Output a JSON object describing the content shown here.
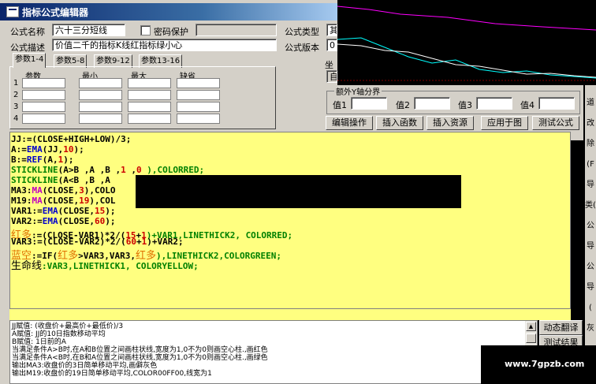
{
  "window": {
    "title": "指标公式编辑器"
  },
  "form": {
    "name_label": "公式名称",
    "name_value": "六十三分短线",
    "password_label": "密码保护",
    "type_label": "公式类型",
    "type_value": "其",
    "desc_label": "公式描述",
    "desc_value": "价值二千的指标K线红指标绿小心",
    "version_label": "公式版本",
    "version_value": "0",
    "coord_label": "坐",
    "self_label": "自"
  },
  "params": {
    "tabs": [
      "参数1-4",
      "参数5-8",
      "参数9-12",
      "参数13-16"
    ],
    "headers": [
      "参数",
      "最小",
      "最大",
      "缺省"
    ],
    "rows": [
      "1",
      "2",
      "3",
      "4"
    ]
  },
  "axis": {
    "group_label": "额外Y轴分界",
    "values": [
      "值1",
      "值2",
      "值3",
      "值4"
    ]
  },
  "buttons": {
    "edit": "编辑操作",
    "insert_func": "插入函数",
    "insert_res": "插入资源",
    "apply": "应用于图",
    "test": "测试公式"
  },
  "code": {
    "l1": "JJ:=(CLOSE+HIGH+LOW)/3;",
    "l2a": "A:=",
    "l2b": "EMA",
    "l2c": "(JJ,",
    "l2d": "10",
    "l2e": ");",
    "l3a": "B:=",
    "l3b": "REF",
    "l3c": "(A,",
    "l3d": "1",
    "l3e": ");",
    "l4a": "STICKLINE",
    "l4b": "(A>B ,A ,B ,",
    "l4c": "1",
    "l4d": " ,",
    "l4e": "0",
    "l4f": " ),COLORRED;",
    "l5a": "STICKLINE",
    "l5b": "(A<B ,B ,A",
    "l6a": "MA3:",
    "l6b": "MA",
    "l6c": "(CLOSE,",
    "l6d": "3",
    "l6e": "),COLO",
    "l7a": "M19:",
    "l7b": "MA",
    "l7c": "(CLOSE,",
    "l7d": "19",
    "l7e": "),COL",
    "l8a": "VAR1:=",
    "l8b": "EMA",
    "l8c": "(CLOSE,",
    "l8d": "15",
    "l8e": ");",
    "l9a": "VAR2:=",
    "l9b": "EMA",
    "l9c": "(CLOSE,",
    "l9d": "60",
    "l9e": ");",
    "l10a": "红多",
    "l10b": ":=(CLOSE-VAR1)*2/(",
    "l10c": "15",
    "l10d": "+",
    "l10e": "1",
    "l10f": ")+VAR1,LINETHICK2, COLORRED;",
    "l11a": "VAR3:=(CLOSE-VAR2)*2/(",
    "l11b": "60",
    "l11c": "+",
    "l11d": "1",
    "l11e": ")+VAR2;",
    "l12a": "蓝空",
    "l12b": ":=IF(",
    "l12c": "红多",
    "l12d": ">VAR3,VAR3,",
    "l12e": "红多",
    "l12f": "),LINETHICK2,COLORGREEN;",
    "l13a": "生命线",
    "l13b": ":VAR3,LINETHICK1, COLORYELLOW;"
  },
  "output": [
    "JJ赋值: (收盘价+最高价+最低价)/3",
    "A赋值: JJ的10日指数移动平均",
    "B赋值: 1日前的A",
    "当满足条件A>B时,在A和B位置之间画柱状线,宽度为1,0不为0则画空心柱.,画红色",
    "当满足条件A<B时,在B和A位置之间画柱状线,宽度为1,0不为0则画空心柱.,画绿色",
    "输出MA3:收盘价的3日简单移动平均,画僻灰色",
    "输出M19:收盘价的19日简单移动平均,COLOR00FF00,线宽为1"
  ],
  "side_buttons": {
    "translate": "动态翻译",
    "test_result": "测试结果"
  },
  "edge_chars": [
    "道",
    "改",
    "除",
    "(F",
    "导",
    "类(",
    "公",
    "导",
    "公",
    "导",
    "(",
    "灰"
  ],
  "watermark": "www.7gpzb.com",
  "colors": {
    "editor_bg": "#ffff80",
    "window_bg": "#d4d0c8",
    "title_start": "#0a246a"
  }
}
